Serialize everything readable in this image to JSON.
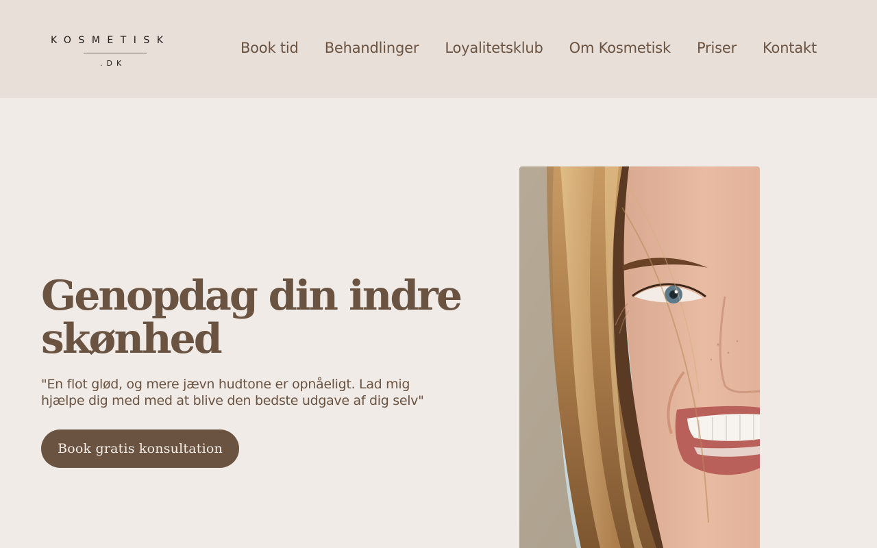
{
  "brand": {
    "logo_word": "KOSMETISK",
    "logo_sub": ".DK"
  },
  "nav": {
    "items": [
      {
        "label": "Book tid"
      },
      {
        "label": "Behandlinger"
      },
      {
        "label": "Loyalitetsklub"
      },
      {
        "label": "Om Kosmetisk"
      },
      {
        "label": "Priser"
      },
      {
        "label": "Kontakt"
      }
    ]
  },
  "hero": {
    "title": "Genopdag din indre skønhed",
    "quote": "\"En flot glød, og mere jævn hudtone er opnåeligt. Lad mig hjælpe dig med med at blive den bedste udgave af dig selv\"",
    "cta_label": "Book gratis konsultation"
  },
  "colors": {
    "header_bg": "#e8dfd9",
    "page_bg": "#f0ebe7",
    "accent_brown": "#6b5341",
    "button_text": "#f6efe9"
  }
}
